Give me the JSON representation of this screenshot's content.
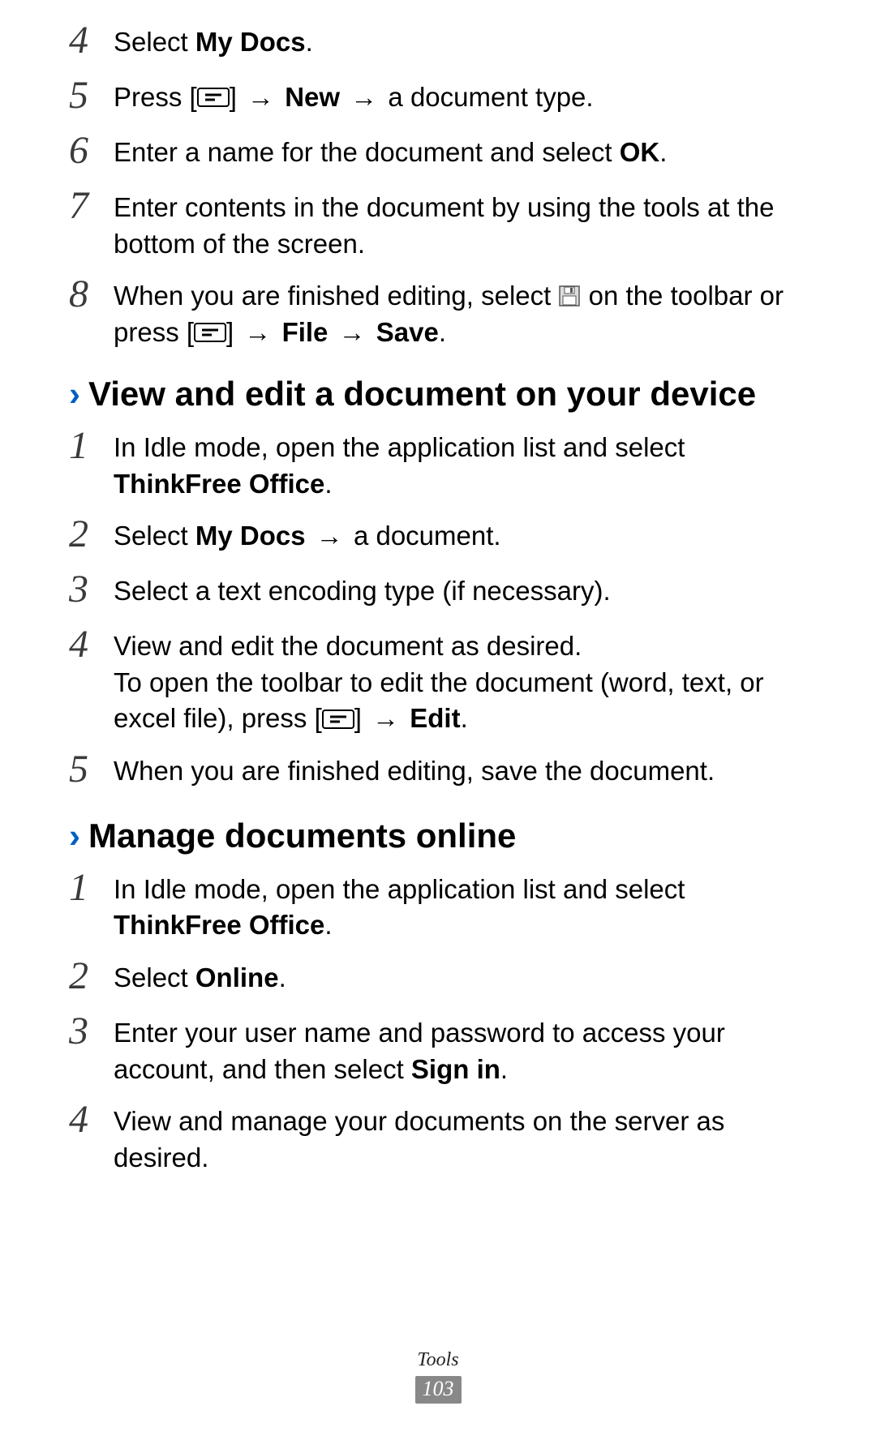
{
  "steps_top": [
    {
      "num": "4",
      "html": "Select <strong>My Docs</strong>."
    },
    {
      "num": "5",
      "html": "Press [MENU_ICON] <span class='arrow'>→</span> <strong>New</strong> <span class='arrow'>→</span> a document type."
    },
    {
      "num": "6",
      "html": "Enter a name for the document and select <strong>OK</strong>."
    },
    {
      "num": "7",
      "html": "Enter contents in the document by using the tools at the bottom of the screen."
    },
    {
      "num": "8",
      "html": "When you are finished editing, select SAVE_ICON on the toolbar or press [MENU_ICON] <span class='arrow'>→</span> <strong>File</strong> <span class='arrow'>→</span> <strong>Save</strong>."
    }
  ],
  "section1": {
    "title": "View and edit a document on your device",
    "steps": [
      {
        "num": "1",
        "html": "In Idle mode, open the application list and select <strong>ThinkFree Office</strong>."
      },
      {
        "num": "2",
        "html": "Select <strong>My Docs</strong> <span class='arrow'>→</span> a document."
      },
      {
        "num": "3",
        "html": "Select a text encoding type (if necessary)."
      },
      {
        "num": "4",
        "html": "View and edit the document as desired.<br>To open the toolbar to edit the document (word, text, or excel file), press [MENU_ICON] <span class='arrow'>→</span> <strong>Edit</strong>."
      },
      {
        "num": "5",
        "html": "When you are finished editing, save the document."
      }
    ]
  },
  "section2": {
    "title": "Manage documents online",
    "steps": [
      {
        "num": "1",
        "html": "In Idle mode, open the application list and select <strong>ThinkFree Office</strong>."
      },
      {
        "num": "2",
        "html": "Select <strong>Online</strong>."
      },
      {
        "num": "3",
        "html": "Enter your user name and password to access your account, and then select <strong>Sign in</strong>."
      },
      {
        "num": "4",
        "html": "View and manage your documents on the server as desired."
      }
    ]
  },
  "footer": {
    "category": "Tools",
    "page": "103"
  },
  "icons": {
    "menu": "<span class='icon' data-name='menu-key-icon' data-interactable='false'><svg width='40' height='24' viewBox='0 0 40 24'><rect x='1' y='1' width='38' height='22' rx='3' ry='3' fill='none' stroke='#000' stroke-width='2'/><line x1='10' y1='9' x2='30' y2='9' stroke='#000' stroke-width='3'/><line x1='10' y1='15' x2='22' y2='15' stroke='#000' stroke-width='3'/></svg></span>",
    "save": "<span class='icon' data-name='save-disk-icon' data-interactable='false'><svg width='28' height='28' viewBox='0 0 28 28'><rect x='2' y='2' width='24' height='24' fill='#ddd' stroke='#555' stroke-width='1.5'/><rect x='8' y='3' width='12' height='8' fill='#fff' stroke='#555' stroke-width='1'/><rect x='15' y='4' width='3' height='6' fill='#555'/><rect x='6' y='14' width='16' height='11' fill='#fff' stroke='#555' stroke-width='1'/></svg></span>"
  }
}
